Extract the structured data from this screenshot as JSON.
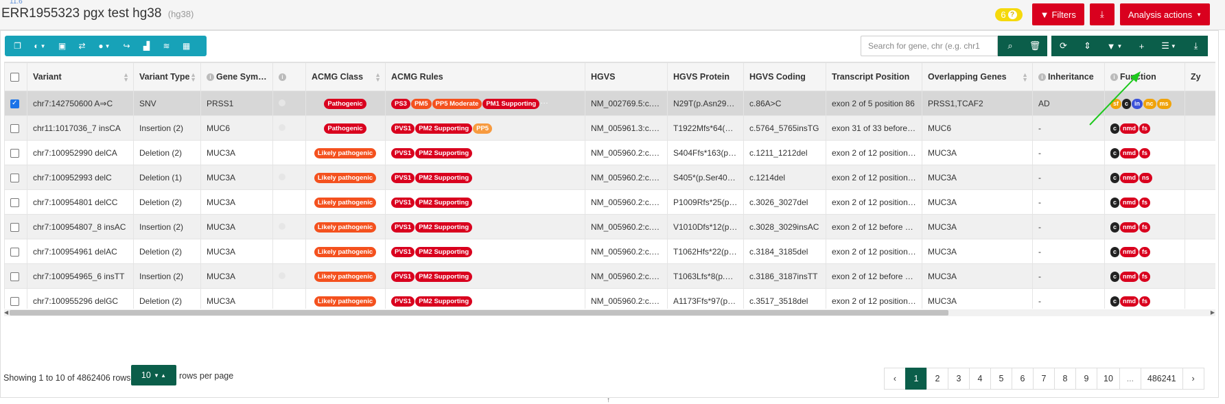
{
  "header": {
    "version": "11.6",
    "title": "ERR1955323 pgx test hg38",
    "assembly": "(hg38)",
    "notif_count": "6",
    "filters_label": "Filters",
    "analysis_actions_label": "Analysis actions"
  },
  "search": {
    "placeholder": "Search for gene, chr (e.g. chr1"
  },
  "table": {
    "columns": [
      "Variant",
      "Variant Type",
      "Gene Symbol",
      "",
      "ACMG Class",
      "ACMG Rules",
      "HGVS",
      "HGVS Protein",
      "HGVS Coding",
      "Transcript Position",
      "Overlapping Genes",
      "Inheritance",
      "Function",
      "Zy"
    ],
    "rows": [
      {
        "variant": "chr7:142750600 A⇒C",
        "type": "SNV",
        "gene": "PRSS1",
        "dot": true,
        "acmg_class": "Pathogenic",
        "class_style": "pathogenic",
        "rules": [
          {
            "t": "PS3",
            "s": "strong"
          },
          {
            "t": "PM5",
            "s": "mod"
          },
          {
            "t": "PP5 Moderate",
            "s": "mod"
          },
          {
            "t": "PM1 Supporting",
            "s": "strong"
          },
          {
            "t": "PM2 Supporting",
            "s": "strong"
          }
        ],
        "hgvs": "NM_002769.5:c.86A>C",
        "protein": "N29T(p.Asn29Thr)",
        "coding": "c.86A>C",
        "transcript": "exon 2 of 5 position 86",
        "overlapping": "PRSS1,TCAF2",
        "inheritance": "AD",
        "functions": [
          {
            "t": "sf",
            "c": "orange"
          },
          {
            "t": "c",
            "c": "black"
          },
          {
            "t": "in",
            "c": "blue"
          },
          {
            "t": "nc",
            "c": "orange"
          },
          {
            "t": "ms",
            "c": "orange"
          }
        ]
      },
      {
        "variant": "chr11:1017036_7 insCA",
        "type": "Insertion (2)",
        "gene": "MUC6",
        "dot": true,
        "acmg_class": "Pathogenic",
        "class_style": "pathogenic",
        "rules": [
          {
            "t": "PVS1",
            "s": "strong"
          },
          {
            "t": "PM2 Supporting",
            "s": "strong"
          },
          {
            "t": "PP5",
            "s": "sup"
          }
        ],
        "hgvs": "NM_005961.3:c.5764_5765insTG",
        "protein": "T1922Mfs*64(p.Thr1922fs)",
        "coding": "c.5764_5765insTG",
        "transcript": "exon 31 of 33 before position",
        "overlapping": "MUC6",
        "inheritance": "-",
        "functions": [
          {
            "t": "c",
            "c": "black"
          },
          {
            "t": "nmd",
            "c": "red"
          },
          {
            "t": "fs",
            "c": "red"
          }
        ]
      },
      {
        "variant": "chr7:100952990 delCA",
        "type": "Deletion (2)",
        "gene": "MUC3A",
        "dot": false,
        "acmg_class": "Likely pathogenic",
        "class_style": "likely",
        "rules": [
          {
            "t": "PVS1",
            "s": "strong"
          },
          {
            "t": "PM2 Supporting",
            "s": "strong"
          }
        ],
        "hgvs": "NM_005960.2:c.1211_1212del",
        "protein": "S404Ffs*163(p.Ser404fs)",
        "coding": "c.1211_1212del",
        "transcript": "exon 2 of 12 position 1211",
        "overlapping": "MUC3A",
        "inheritance": "-",
        "functions": [
          {
            "t": "c",
            "c": "black"
          },
          {
            "t": "nmd",
            "c": "red"
          },
          {
            "t": "fs",
            "c": "red"
          }
        ]
      },
      {
        "variant": "chr7:100952993 delC",
        "type": "Deletion (1)",
        "gene": "MUC3A",
        "dot": true,
        "acmg_class": "Likely pathogenic",
        "class_style": "likely",
        "rules": [
          {
            "t": "PVS1",
            "s": "strong"
          },
          {
            "t": "PM2 Supporting",
            "s": "strong"
          }
        ],
        "hgvs": "NM_005960.2:c.1214del",
        "protein": "S405*(p.Ser405Ter)",
        "coding": "c.1214del",
        "transcript": "exon 2 of 12 position 1214",
        "overlapping": "MUC3A",
        "inheritance": "-",
        "functions": [
          {
            "t": "c",
            "c": "black"
          },
          {
            "t": "nmd",
            "c": "red"
          },
          {
            "t": "ns",
            "c": "red"
          }
        ]
      },
      {
        "variant": "chr7:100954801 delCC",
        "type": "Deletion (2)",
        "gene": "MUC3A",
        "dot": false,
        "acmg_class": "Likely pathogenic",
        "class_style": "likely",
        "rules": [
          {
            "t": "PVS1",
            "s": "strong"
          },
          {
            "t": "PM2 Supporting",
            "s": "strong"
          }
        ],
        "hgvs": "NM_005960.2:c.3026_3027del",
        "protein": "P1009Rfs*25(p.Pro1009fs)",
        "coding": "c.3026_3027del",
        "transcript": "exon 2 of 12 position 3026",
        "overlapping": "MUC3A",
        "inheritance": "-",
        "functions": [
          {
            "t": "c",
            "c": "black"
          },
          {
            "t": "nmd",
            "c": "red"
          },
          {
            "t": "fs",
            "c": "red"
          }
        ]
      },
      {
        "variant": "chr7:100954807_8 insAC",
        "type": "Insertion (2)",
        "gene": "MUC3A",
        "dot": true,
        "acmg_class": "Likely pathogenic",
        "class_style": "likely",
        "rules": [
          {
            "t": "PVS1",
            "s": "strong"
          },
          {
            "t": "PM2 Supporting",
            "s": "strong"
          }
        ],
        "hgvs": "NM_005960.2:c.3028_3029insAC",
        "protein": "V1010Dfs*12(p.Val1010fs)",
        "coding": "c.3028_3029insAC",
        "transcript": "exon 2 of 12 before position",
        "overlapping": "MUC3A",
        "inheritance": "-",
        "functions": [
          {
            "t": "c",
            "c": "black"
          },
          {
            "t": "nmd",
            "c": "red"
          },
          {
            "t": "fs",
            "c": "red"
          }
        ]
      },
      {
        "variant": "chr7:100954961 delAC",
        "type": "Deletion (2)",
        "gene": "MUC3A",
        "dot": false,
        "acmg_class": "Likely pathogenic",
        "class_style": "likely",
        "rules": [
          {
            "t": "PVS1",
            "s": "strong"
          },
          {
            "t": "PM2 Supporting",
            "s": "strong"
          }
        ],
        "hgvs": "NM_005960.2:c.3184_3185del",
        "protein": "T1062Hfs*22(p.Thr1062fs)",
        "coding": "c.3184_3185del",
        "transcript": "exon 2 of 12 position 3184",
        "overlapping": "MUC3A",
        "inheritance": "-",
        "functions": [
          {
            "t": "c",
            "c": "black"
          },
          {
            "t": "nmd",
            "c": "red"
          },
          {
            "t": "fs",
            "c": "red"
          }
        ]
      },
      {
        "variant": "chr7:100954965_6 insTT",
        "type": "Insertion (2)",
        "gene": "MUC3A",
        "dot": true,
        "acmg_class": "Likely pathogenic",
        "class_style": "likely",
        "rules": [
          {
            "t": "PVS1",
            "s": "strong"
          },
          {
            "t": "PM2 Supporting",
            "s": "strong"
          }
        ],
        "hgvs": "NM_005960.2:c.3186_3187insTT",
        "protein": "T1063Lfs*8(p.Thr1063fs)",
        "coding": "c.3186_3187insTT",
        "transcript": "exon 2 of 12 before position",
        "overlapping": "MUC3A",
        "inheritance": "-",
        "functions": [
          {
            "t": "c",
            "c": "black"
          },
          {
            "t": "nmd",
            "c": "red"
          },
          {
            "t": "fs",
            "c": "red"
          }
        ]
      },
      {
        "variant": "chr7:100955296 delGC",
        "type": "Deletion (2)",
        "gene": "MUC3A",
        "dot": false,
        "acmg_class": "Likely pathogenic",
        "class_style": "likely",
        "rules": [
          {
            "t": "PVS1",
            "s": "strong"
          },
          {
            "t": "PM2 Supporting",
            "s": "strong"
          }
        ],
        "hgvs": "NM_005960.2:c.3517_3518del",
        "protein": "A1173Ffs*97(p.Ala1173fs)",
        "coding": "c.3517_3518del",
        "transcript": "exon 2 of 12 position 3517",
        "overlapping": "MUC3A",
        "inheritance": "-",
        "functions": [
          {
            "t": "c",
            "c": "black"
          },
          {
            "t": "nmd",
            "c": "red"
          },
          {
            "t": "fs",
            "c": "red"
          }
        ]
      },
      {
        "variant": "chr7:100955299_0 insTC",
        "type": "Insertion (2)",
        "gene": "MUC3A",
        "dot": true,
        "acmg_class": "Likely pathogenic",
        "class_style": "likely",
        "rules": [
          {
            "t": "PVS1",
            "s": "strong"
          },
          {
            "t": "PM2 Supporting",
            "s": "strong"
          }
        ],
        "hgvs": "NM_005960.2:c.3520_3521insTC",
        "protein": "S1174Ffs*9(p.Ser1174fs)",
        "coding": "c.3520_3521insTC",
        "transcript": "exon 2 of 12 before position",
        "overlapping": "MUC3A",
        "inheritance": "-",
        "functions": [
          {
            "t": "c",
            "c": "black"
          },
          {
            "t": "nmd",
            "c": "red"
          },
          {
            "t": "fs",
            "c": "red"
          }
        ]
      }
    ]
  },
  "footer": {
    "showing": "Showing 1 to 10 of 4862406 rows",
    "page_size": "10",
    "rows_per_page": "rows per page",
    "pages": [
      "‹",
      "1",
      "2",
      "3",
      "4",
      "5",
      "6",
      "7",
      "8",
      "9",
      "10",
      "...",
      "486241",
      "›"
    ],
    "active_page": "1"
  }
}
